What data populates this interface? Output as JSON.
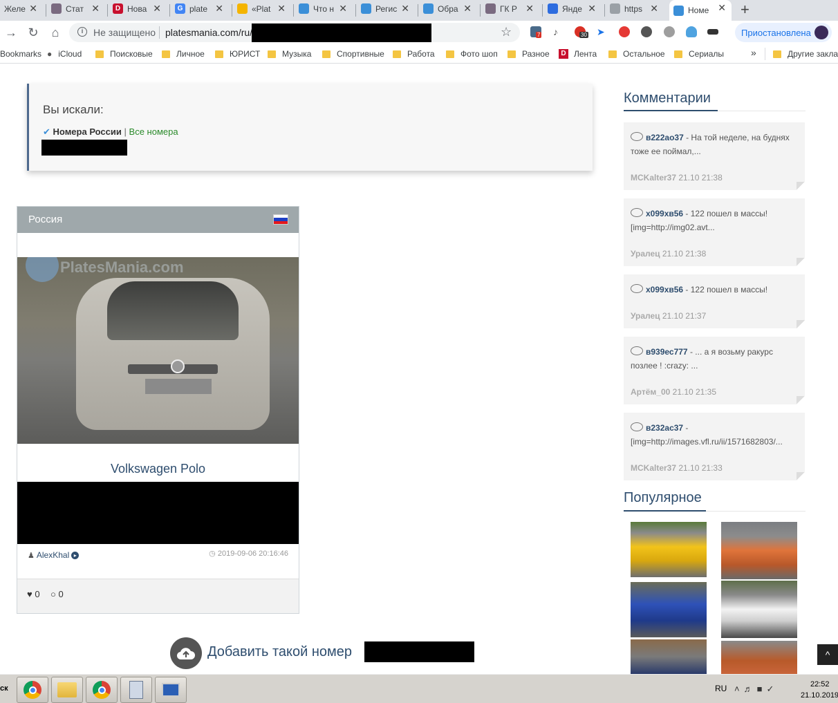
{
  "browser": {
    "tabs": [
      {
        "title": "Желе",
        "color": "#888888",
        "active": false
      },
      {
        "title": "Стат",
        "color": "#7a6a80",
        "active": false
      },
      {
        "title": "Нова",
        "color": "#c8102e",
        "glyph": "D",
        "active": false
      },
      {
        "title": "plate",
        "color": "#4285f4",
        "glyph": "G",
        "active": false
      },
      {
        "title": "«Plat",
        "color": "#f4b400",
        "active": false
      },
      {
        "title": "Что н",
        "color": "#3b8fd8",
        "active": false
      },
      {
        "title": "Регис",
        "color": "#3b8fd8",
        "active": false
      },
      {
        "title": "Обра",
        "color": "#3b8fd8",
        "active": false
      },
      {
        "title": "ГК Р",
        "color": "#7a6a80",
        "active": false
      },
      {
        "title": "Янде",
        "color": "#2d6cdf",
        "active": false
      },
      {
        "title": "https",
        "color": "#9aa0a6",
        "active": false
      },
      {
        "title": "Номе",
        "color": "#3b8fd8",
        "active": true
      }
    ],
    "new_tab": "+",
    "not_secure": "Не защищено",
    "url": "platesmania.com/ru/",
    "ext_badges": {
      "first": "7",
      "third": "30"
    },
    "paused_label": "Приостановлена"
  },
  "bookmarks": {
    "items": [
      "Bookmarks",
      "iCloud",
      "Поисковые",
      "Личное",
      "ЮРИСТ",
      "Музыка",
      "Спортивные",
      "Работа",
      "Фото шоп",
      "Разное",
      "Лента",
      "Остальное",
      "Сериалы"
    ],
    "more": "»",
    "other": "Другие заклад"
  },
  "search": {
    "title": "Вы искали:",
    "filter_strong": "Номера России",
    "separator": "|",
    "filter_link": "Все номера"
  },
  "card": {
    "region": "Россия",
    "watermark": "PlatesMania.com",
    "model": "Volkswagen Polo",
    "author": "AlexKhal",
    "date": "2019-09-06 20:16:46",
    "likes": "0",
    "comments": "0"
  },
  "add_number": {
    "label": "Добавить такой номер"
  },
  "sidebar": {
    "comments_title": "Комментарии",
    "comments": [
      {
        "plate": "в222ао37",
        "text": " - На той неделе, на буднях тоже ее поймал,...",
        "user": "MCKalter37",
        "time": "21.10 21:38"
      },
      {
        "plate": "х099хв56",
        "text": " - 122 пошел в массы! [img=http://img02.avt...",
        "user": "Уралец",
        "time": "21.10 21:38"
      },
      {
        "plate": "х099хв56",
        "text": " - 122 пошел в массы!",
        "user": "Уралец",
        "time": "21.10 21:37"
      },
      {
        "plate": "в939ес777",
        "text": " - ... а я возьму ракурс позлее ! :crazy: ...",
        "user": "Артём_00",
        "time": "21.10 21:35"
      },
      {
        "plate": "в232ас37",
        "text": " - [img=http://images.vfl.ru/ii/1571682803/...",
        "user": "MCKalter37",
        "time": "21.10 21:33"
      }
    ],
    "popular_title": "Популярное"
  },
  "scroll_top": "^",
  "taskbar": {
    "start_fragment": "ск",
    "lang": "RU",
    "time": "22:52",
    "date": "21.10.2019"
  }
}
